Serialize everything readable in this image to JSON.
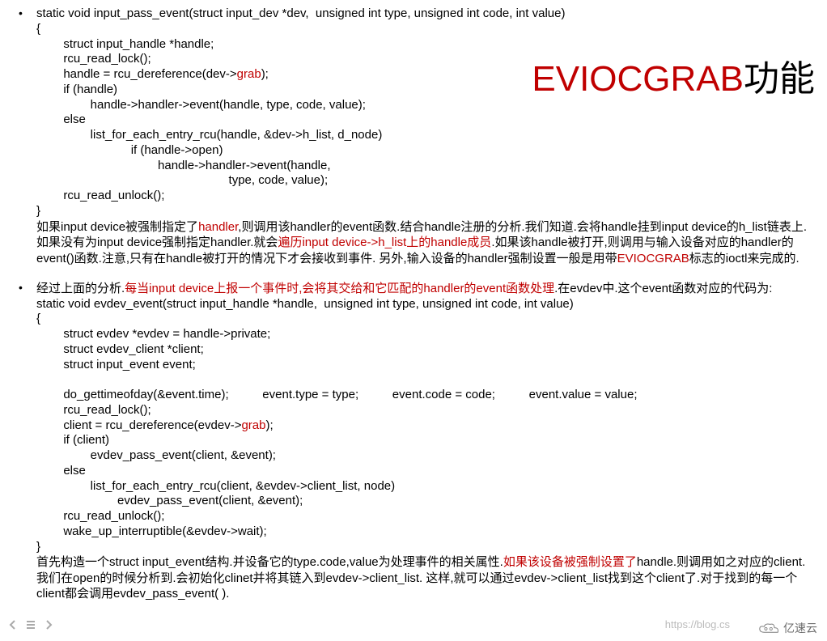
{
  "title": {
    "en": "EVIOCGRAB",
    "cn": "功能"
  },
  "block1": {
    "code": "static void input_pass_event(struct input_dev *dev,  unsigned int type, unsigned int code, int value)\n{\n        struct input_handle *handle;\n        rcu_read_lock();\n        handle = rcu_dereference(dev->",
    "grab": "grab",
    "code_after_grab": ");\n        if (handle)\n                handle->handler->event(handle, type, code, value);\n        else\n                list_for_each_entry_rcu(handle, &dev->h_list, d_node)\n                            if (handle->open)\n                                    handle->handler->event(handle,\n                                                         type, code, value);\n        rcu_read_unlock();\n}",
    "p1a": "如果input device被强制指定了",
    "p1_handler": "handler",
    "p1b": ",则调用该handler的event函数.结合handle注册的分析.我们知道.会将handle挂到input device的h_list链表上.如果没有为input device强制指定handler.就会",
    "p1_red2": "遍历input device->h_list上的handle成员",
    "p1c": ".如果该handle被打开,则调用与输入设备对应的handler的event()函数.注意,只有在handle被打开的情况下才会接收到事件. 另外,输入设备的handler强制设置一般是用带",
    "p1_red3": "EVIOCGRAB",
    "p1d": "标志的ioctl来完成的."
  },
  "block2": {
    "p0a": "经过上面的分析.",
    "p0_red": "每当input device上报一个事件时,会将其交给和它匹配的handler的event函数处理",
    "p0b": ".在evdev中.这个event函数对应的代码为:",
    "code1": "static void evdev_event(struct input_handle *handle,  unsigned int type, unsigned int code, int value)\n{\n        struct evdev *evdev = handle->private;\n        struct evdev_client *client;\n        struct input_event event;\n\n        do_gettimeofday(&event.time);          event.type = type;          event.code = code;          event.value = value;\n        rcu_read_lock();\n        client = rcu_dereference(evdev->",
    "grab": "grab",
    "code2": ");\n        if (client)\n                evdev_pass_event(client, &event);\n        else\n                list_for_each_entry_rcu(client, &evdev->client_list, node)\n                        evdev_pass_event(client, &event);\n        rcu_read_unlock();\n        wake_up_interruptible(&evdev->wait);\n}",
    "p1a": "首先构造一个struct input_event结构.并设备它的type.code,value为处理事件的相关属性.",
    "p1_red": "如果该设备被强制设置了",
    "p1b": "handle.则调用如之对应的client. 我们在open的时候分析到.会初始化clinet并将其链入到evdev->client_list. 这样,就可以通过evdev->client_list找到这个client了.对于找到的每一个client都会调用evdev_pass_event( )."
  },
  "watermark": "https://blog.cs",
  "logo_text": "亿速云"
}
